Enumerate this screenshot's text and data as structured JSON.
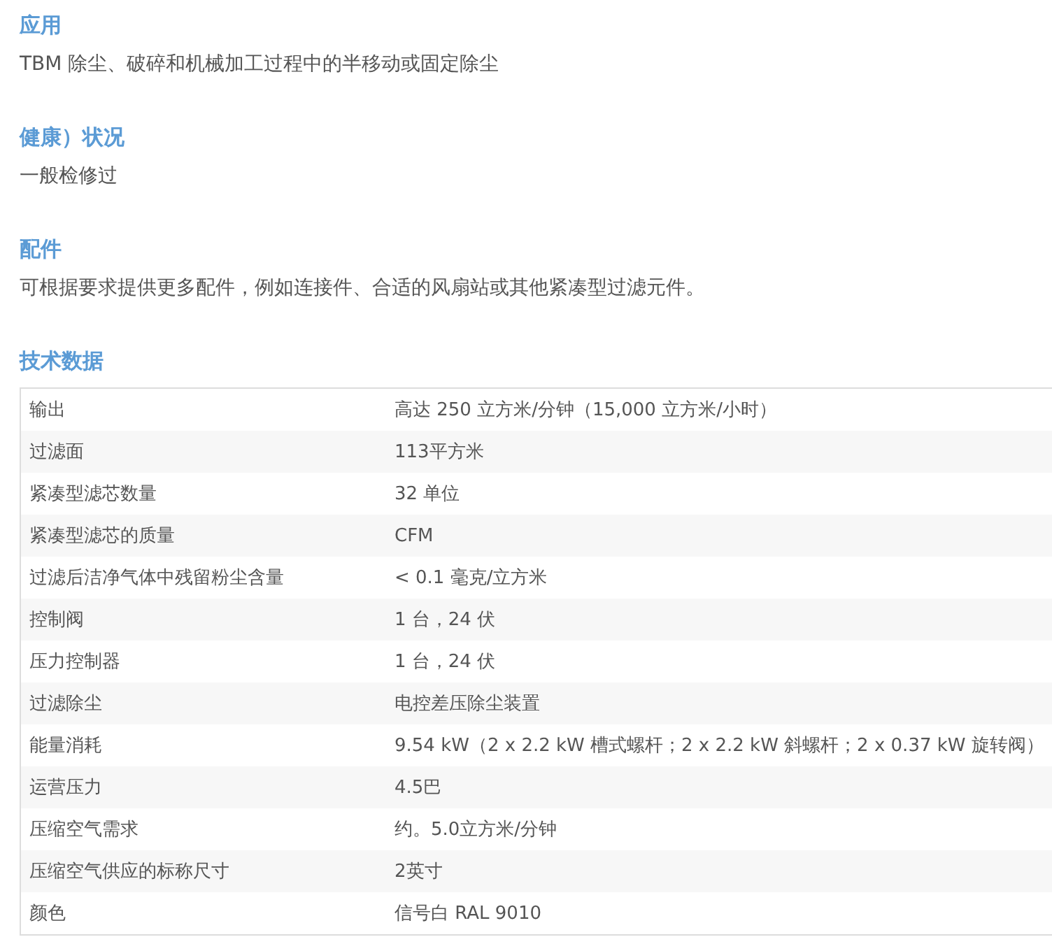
{
  "sections": [
    {
      "heading": "应用",
      "text": "TBM 除尘、破碎和机械加工过程中的半移动或固定除尘"
    },
    {
      "heading": "健康）状况",
      "text": "一般检修过"
    },
    {
      "heading": "配件",
      "text": "可根据要求提供更多配件，例如连接件、合适的风扇站或其他紧凑型过滤元件。"
    }
  ],
  "technical_data": {
    "heading": "技术数据",
    "rows": [
      {
        "label": "输出",
        "value": "高达 250 立方米/分钟（15,000 立方米/小时）"
      },
      {
        "label": "过滤面",
        "value": "113平方米"
      },
      {
        "label": "紧凑型滤芯数量",
        "value": "32 单位"
      },
      {
        "label": "紧凑型滤芯的质量",
        "value": "CFM"
      },
      {
        "label": "过滤后洁净气体中残留粉尘含量",
        "value": "< 0.1 毫克/立方米"
      },
      {
        "label": "控制阀",
        "value": "1 台，24 伏"
      },
      {
        "label": "压力控制器",
        "value": "1 台，24 伏"
      },
      {
        "label": "过滤除尘",
        "value": "电控差压除尘装置"
      },
      {
        "label": "能量消耗",
        "value": "9.54 kW（2 x 2.2 kW 槽式螺杆；2 x 2.2 kW 斜螺杆；2 x 0.37 kW 旋转阀）"
      },
      {
        "label": "运营压力",
        "value": "4.5巴"
      },
      {
        "label": "压缩空气需求",
        "value": "约。5.0立方米/分钟"
      },
      {
        "label": "压缩空气供应的标称尺寸",
        "value": "2英寸"
      },
      {
        "label": "颜色",
        "value": "信号白 RAL 9010"
      }
    ]
  }
}
